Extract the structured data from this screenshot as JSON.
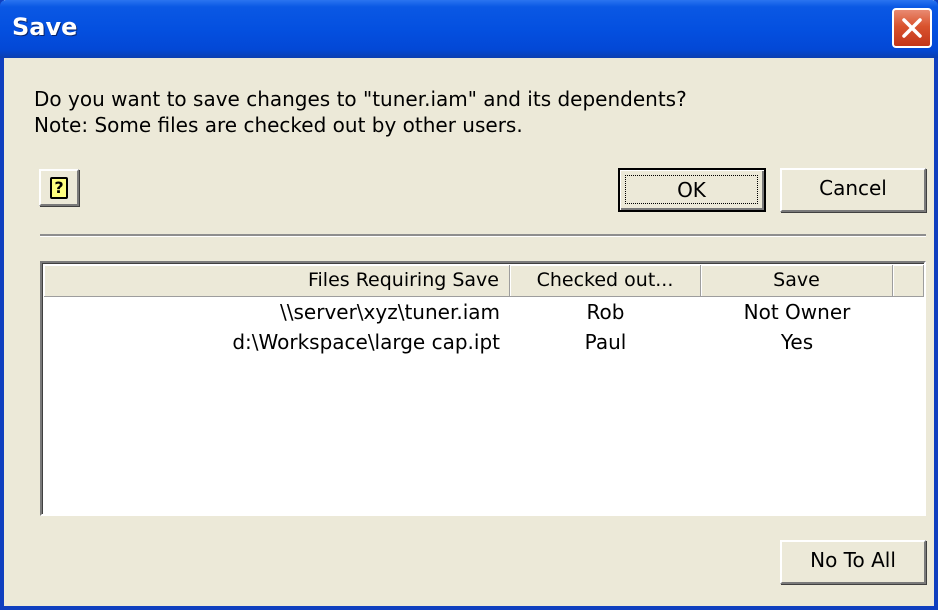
{
  "window": {
    "title": "Save"
  },
  "message": {
    "line1": "Do you want to save changes to \"tuner.iam\" and its dependents?",
    "line2": "Note: Some files are checked out by other users."
  },
  "buttons": {
    "help_glyph": "?",
    "ok": "OK",
    "cancel": "Cancel",
    "no_to_all": "No To All"
  },
  "table": {
    "headers": [
      "Files Requiring Save",
      "Checked out...",
      "Save",
      ""
    ],
    "rows": [
      {
        "file": "\\\\server\\xyz\\tuner.iam",
        "checked_out": "Rob",
        "save": "Not Owner"
      },
      {
        "file": "d:\\Workspace\\large cap.ipt",
        "checked_out": "Paul",
        "save": "Yes"
      }
    ]
  },
  "icons": {
    "close": "close-icon",
    "help": "help-icon"
  },
  "colors": {
    "titlebar": "#0450e0",
    "window_bg": "#ece9d8",
    "close_button": "#d9532e"
  }
}
